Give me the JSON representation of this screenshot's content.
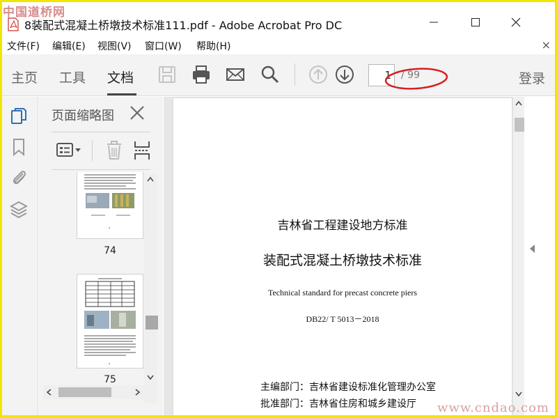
{
  "watermark_top": "中国道桥网",
  "watermark_bottom": "www.cndao.com",
  "window": {
    "title": "8装配式混凝土桥墩技术标准111.pdf - Adobe Acrobat Pro DC"
  },
  "menu": {
    "items": [
      "文件(F)",
      "编辑(E)",
      "视图(V)",
      "窗口(W)",
      "帮助(H)"
    ],
    "close": "×"
  },
  "toolbar": {
    "tabs": [
      "主页",
      "工具",
      "文档"
    ],
    "active_tab": "文档",
    "page_current": "1",
    "page_total": "/ 99",
    "login": "登录",
    "icons": [
      "save-icon",
      "print-icon",
      "email-icon",
      "search-icon",
      "arrow-up-icon",
      "arrow-down-icon"
    ]
  },
  "thumbnails": {
    "panel_title": "页面缩略图",
    "pages": [
      {
        "label": "74"
      },
      {
        "label": "75"
      }
    ]
  },
  "document": {
    "title_line1": "吉林省工程建设地方标准",
    "title_line2": "装配式混凝土桥墩技术标准",
    "english_title": "Technical standard for precast concrete piers",
    "code": "DB22/ T 5013－2018",
    "editor_dept": "主编部门：吉林省建设标准化管理办公室",
    "approve_dept": "批准部门：吉林省住房和城乡建设厅"
  },
  "colors": {
    "accent_blue": "#2f6fb5",
    "annotation_red": "#d62020",
    "border_yellow": "#f2e600"
  }
}
